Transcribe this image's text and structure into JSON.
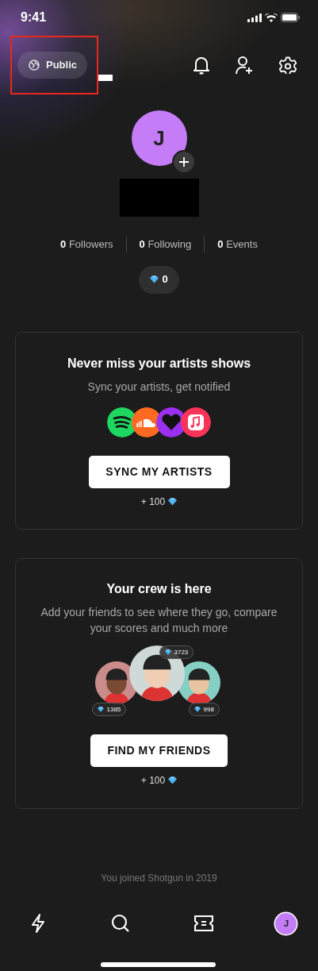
{
  "status_bar": {
    "time": "9:41"
  },
  "visibility": {
    "label": "Public"
  },
  "profile": {
    "initial": "J"
  },
  "stats": [
    {
      "count": "0",
      "label": "Followers"
    },
    {
      "count": "0",
      "label": "Following"
    },
    {
      "count": "0",
      "label": "Events"
    }
  ],
  "gems": {
    "count": "0"
  },
  "sync_card": {
    "title": "Never miss your artists shows",
    "subtitle": "Sync your artists, get notified",
    "button": "SYNC MY ARTISTS",
    "reward": "+ 100"
  },
  "crew_card": {
    "title": "Your crew is here",
    "subtitle": "Add your friends to see where they go, compare your scores and much more",
    "friends": [
      {
        "score": "1385"
      },
      {
        "score": "3723"
      },
      {
        "score": "998"
      }
    ],
    "button": "FIND MY FRIENDS",
    "reward": "+ 100"
  },
  "footer": "You joined Shotgun in 2019",
  "tabs": [
    {
      "kind": "feed"
    },
    {
      "kind": "search"
    },
    {
      "kind": "tickets"
    },
    {
      "kind": "profile",
      "initial": "J"
    }
  ]
}
